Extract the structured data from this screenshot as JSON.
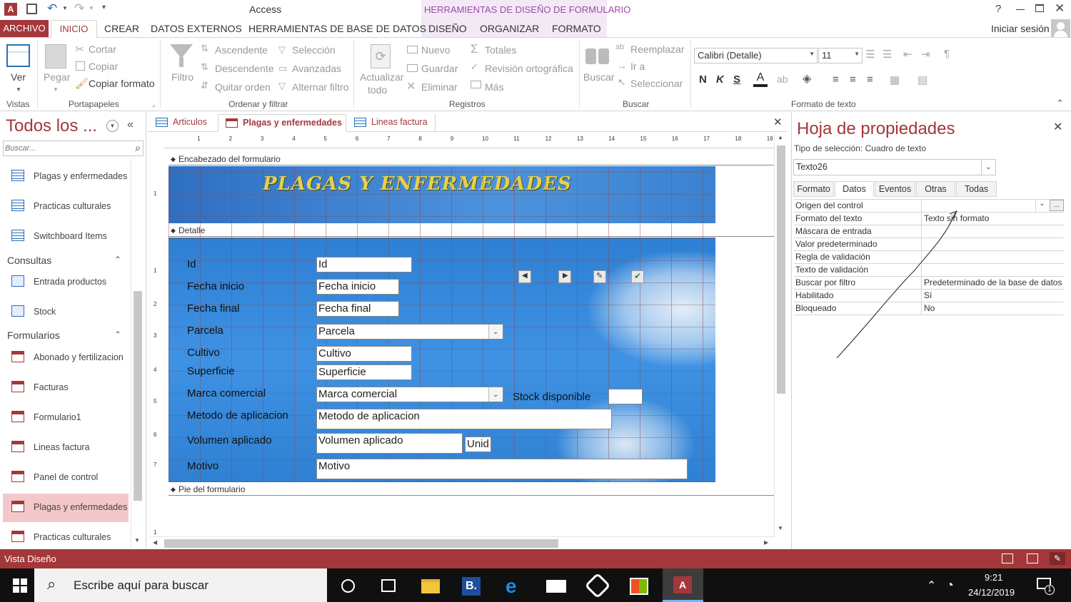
{
  "window": {
    "title": "Access",
    "context_title": "HERRAMIENTAS DE DISEÑO DE FORMULARIO",
    "help": "?",
    "signin": "Iniciar sesión"
  },
  "tabs": [
    "ARCHIVO",
    "INICIO",
    "CREAR",
    "DATOS EXTERNOS",
    "HERRAMIENTAS DE BASE DE DATOS",
    "DISEÑO",
    "ORGANIZAR",
    "FORMATO"
  ],
  "ribbon": {
    "vistas": {
      "ver": "Ver",
      "label": "Vistas"
    },
    "portapapeles": {
      "pegar": "Pegar",
      "cortar": "Cortar",
      "copiar": "Copiar",
      "copiar_formato": "Copiar formato",
      "label": "Portapapeles"
    },
    "ordenar": {
      "filtro": "Filtro",
      "ascendente": "Ascendente",
      "descendente": "Descendente",
      "quitar_orden": "Quitar orden",
      "seleccion": "Selección",
      "avanzadas": "Avanzadas",
      "alternar": "Alternar filtro",
      "label": "Ordenar y filtrar"
    },
    "registros": {
      "actualizar": "Actualizar",
      "todo": "todo",
      "nuevo": "Nuevo",
      "guardar": "Guardar",
      "eliminar": "Eliminar",
      "totales": "Totales",
      "revision": "Revisión ortográfica",
      "mas": "Más",
      "label": "Registros"
    },
    "buscar": {
      "buscar": "Buscar",
      "reemplazar": "Reemplazar",
      "ira": "Ir a",
      "seleccionar": "Seleccionar",
      "label": "Buscar"
    },
    "formato_texto": {
      "font": "Calibri (Detalle)",
      "size": "11",
      "bold": "N",
      "italic": "K",
      "underline": "S",
      "font_color_letter": "A",
      "label": "Formato de texto"
    }
  },
  "nav": {
    "title": "Todos los ...",
    "search_placeholder": "Buscar...",
    "tables": [
      "Plagas y enfermedades",
      "Practicas culturales",
      "Switchboard Items"
    ],
    "consultas_label": "Consultas",
    "consultas": [
      "Entrada productos",
      "Stock"
    ],
    "formularios_label": "Formularios",
    "formularios": [
      "Abonado y fertilizacion",
      "Facturas",
      "Formulario1",
      "Lineas factura",
      "Panel de control",
      "Plagas y enfermedades",
      "Practicas culturales"
    ]
  },
  "doc_tabs": [
    "Articulos",
    "Plagas y enfermedades",
    "Lineas factura"
  ],
  "ruler_numbers": [
    "1",
    "2",
    "3",
    "4",
    "5",
    "6",
    "7",
    "8",
    "9",
    "10",
    "11",
    "12",
    "13",
    "14",
    "15",
    "16",
    "17",
    "18",
    "19"
  ],
  "vruler_numbers": [
    "1",
    "1",
    "2",
    "3",
    "4",
    "5",
    "6",
    "7",
    "1"
  ],
  "form": {
    "header_section": "Encabezado del formulario",
    "detail_section": "Detalle",
    "footer_section": "Pie del formulario",
    "title": "PLAGAS Y ENFERMEDADES",
    "fields": [
      {
        "label": "Id",
        "value": "Id"
      },
      {
        "label": "Fecha inicio",
        "value": "Fecha inicio"
      },
      {
        "label": "Fecha final",
        "value": "Fecha final"
      },
      {
        "label": "Parcela",
        "value": "Parcela"
      },
      {
        "label": "Cultivo",
        "value": "Cultivo"
      },
      {
        "label": "Superficie",
        "value": "Superficie"
      },
      {
        "label": "Marca comercial",
        "value": "Marca comercial"
      },
      {
        "label": "Metodo de aplicacion",
        "value": "Metodo de aplicacion"
      },
      {
        "label": "Volumen aplicado",
        "value": "Volumen aplicado"
      },
      {
        "label": "Motivo",
        "value": "Motivo"
      }
    ],
    "stock_label": "Stock disponible",
    "unid": "Unid"
  },
  "props": {
    "title": "Hoja de propiedades",
    "selection_type": "Tipo de selección:  Cuadro de texto",
    "object": "Texto26",
    "tabs": [
      "Formato",
      "Datos",
      "Eventos",
      "Otras",
      "Todas"
    ],
    "rows": [
      {
        "k": "Origen del control",
        "v": ""
      },
      {
        "k": "Formato del texto",
        "v": "Texto sin formato"
      },
      {
        "k": "Máscara de entrada",
        "v": ""
      },
      {
        "k": "Valor predeterminado",
        "v": ""
      },
      {
        "k": "Regla de validación",
        "v": ""
      },
      {
        "k": "Texto de validación",
        "v": ""
      },
      {
        "k": "Buscar por filtro",
        "v": "Predeterminado de la base de datos"
      },
      {
        "k": "Habilitado",
        "v": "Sí"
      },
      {
        "k": "Bloqueado",
        "v": "No"
      }
    ]
  },
  "status": {
    "text": "Vista Diseño"
  },
  "taskbar": {
    "search": "Escribe aquí para buscar",
    "time": "9:21",
    "date": "24/12/2019",
    "notif": "1"
  },
  "colors": {
    "accent": "#a4373a",
    "context": "#9d4ba8",
    "form_bg": "#2f82d6",
    "title_gold": "#e8d04a"
  }
}
